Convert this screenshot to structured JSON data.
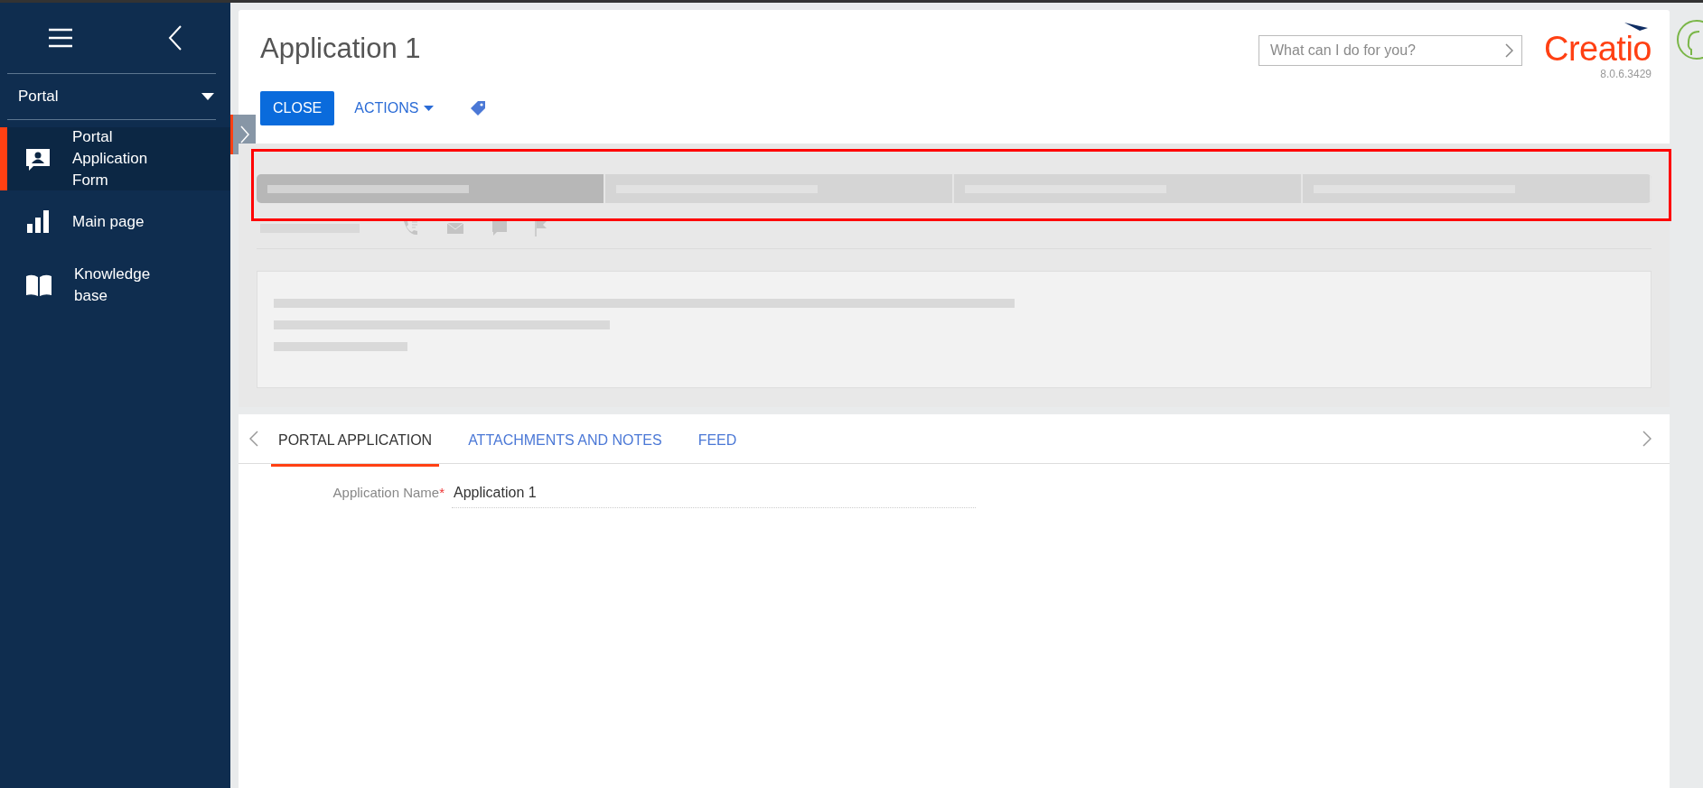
{
  "sidebar": {
    "workspace": "Portal",
    "items": [
      {
        "label": "Portal Application Form",
        "selected": true
      },
      {
        "label": "Main page",
        "selected": false
      },
      {
        "label": "Knowledge base",
        "selected": false
      }
    ]
  },
  "header": {
    "title": "Application 1",
    "buttons": [
      {
        "label": "CLOSE",
        "kind": "primary"
      },
      {
        "label": "ACTIONS",
        "kind": "dropdown"
      },
      {
        "kind": "tag"
      }
    ],
    "search": {
      "placeholder": "What can I do for you?"
    },
    "logo": "Creatio",
    "version": "8.0.6.3429"
  },
  "stages": [
    {
      "selected": true
    },
    {
      "selected": false
    },
    {
      "selected": false
    },
    {
      "selected": false
    }
  ],
  "tabs": [
    {
      "label": "PORTAL APPLICATION",
      "selected": true
    },
    {
      "label": "ATTACHMENTS AND NOTES",
      "selected": false
    },
    {
      "label": "FEED",
      "selected": false
    }
  ],
  "fields": [
    {
      "label": "Application Name",
      "required_mark": "*",
      "value": "Application 1"
    }
  ]
}
